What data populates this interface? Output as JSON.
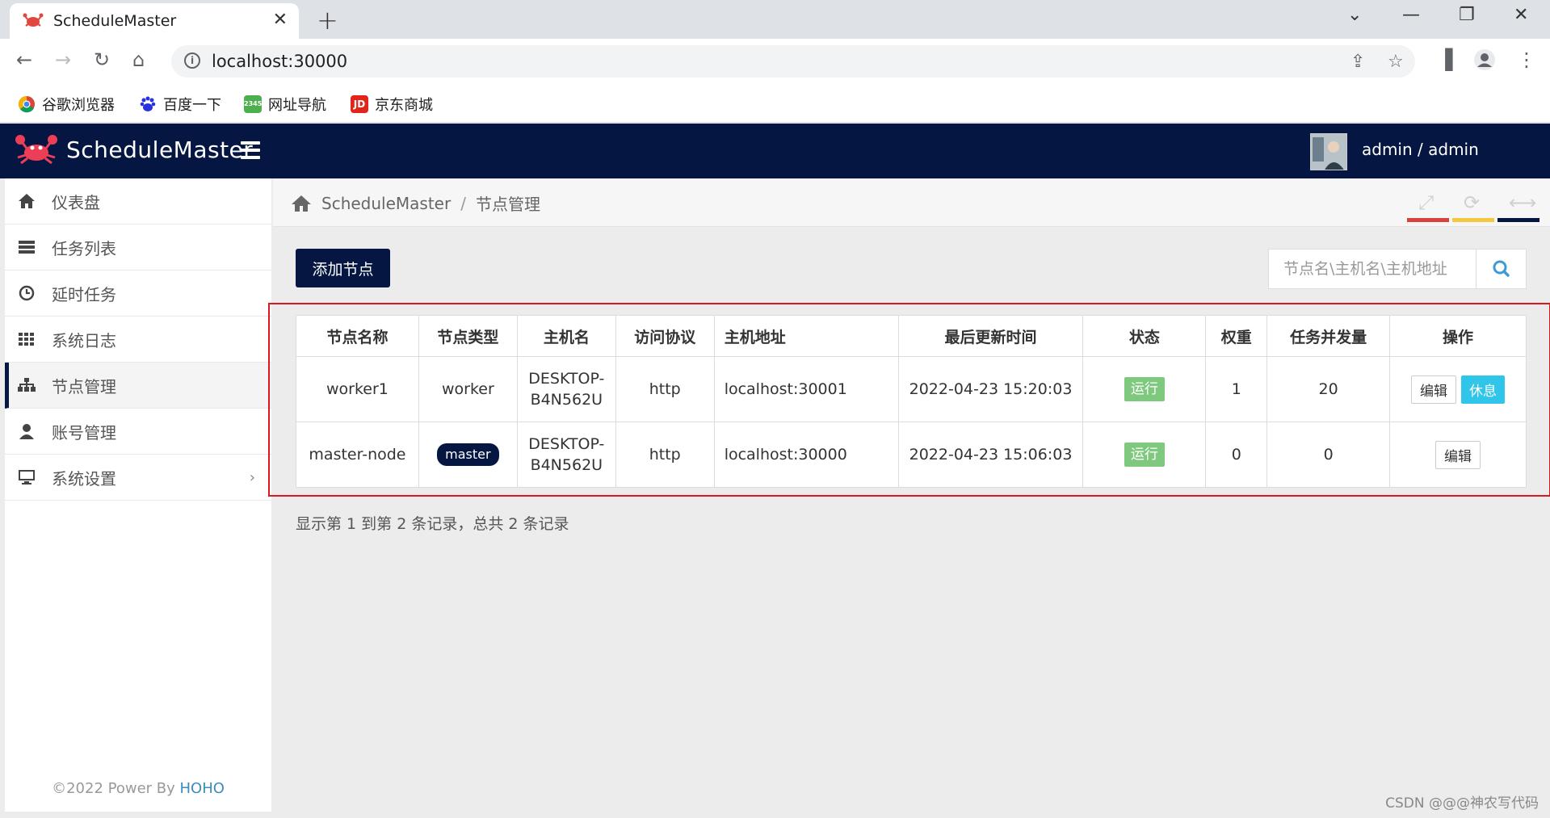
{
  "browser": {
    "tab_title": "ScheduleMaster",
    "tab_close": "✕",
    "new_tab": "+",
    "url": "localhost:30000",
    "bookmarks": [
      {
        "label": "谷歌浏览器",
        "icon": "chrome-icon"
      },
      {
        "label": "百度一下",
        "icon": "baidu-icon"
      },
      {
        "label": "网址导航",
        "icon": "2345-icon"
      },
      {
        "label": "京东商城",
        "icon": "jd-icon"
      }
    ],
    "bookmark_icon_text": {
      "jd": "JD",
      "nav": "2345"
    }
  },
  "header": {
    "brand": "ScheduleMaster",
    "user": "admin / admin"
  },
  "sidebar": {
    "items": [
      {
        "label": "仪表盘",
        "icon": "home-icon"
      },
      {
        "label": "任务列表",
        "icon": "list-icon"
      },
      {
        "label": "延时任务",
        "icon": "clock-icon"
      },
      {
        "label": "系统日志",
        "icon": "grid-icon"
      },
      {
        "label": "节点管理",
        "icon": "sitemap-icon",
        "active": true
      },
      {
        "label": "账号管理",
        "icon": "user-icon"
      },
      {
        "label": "系统设置",
        "icon": "monitor-icon"
      }
    ],
    "chevron": "›",
    "footer_prefix": "©2022 Power By ",
    "footer_link": "HOHO"
  },
  "breadcrumb": {
    "root": "ScheduleMaster",
    "sep": "/",
    "current": "节点管理"
  },
  "toolbar": {
    "add_label": "添加节点",
    "search_placeholder": "节点名\\主机名\\主机地址"
  },
  "table": {
    "headers": [
      "节点名称",
      "节点类型",
      "主机名",
      "访问协议",
      "主机地址",
      "最后更新时间",
      "状态",
      "权重",
      "任务并发量",
      "操作"
    ],
    "rows": [
      {
        "name": "worker1",
        "type": "worker",
        "host_line1": "DESKTOP-",
        "host_line2": "B4N562U",
        "protocol": "http",
        "address": "localhost:30001",
        "updated": "2022-04-23 15:20:03",
        "status": "运行",
        "weight": "1",
        "concurrency": "20",
        "edit": "编辑",
        "rest": "休息"
      },
      {
        "name": "master-node",
        "type": "master",
        "host_line1": "DESKTOP-",
        "host_line2": "B4N562U",
        "protocol": "http",
        "address": "localhost:30000",
        "updated": "2022-04-23 15:06:03",
        "status": "运行",
        "weight": "0",
        "concurrency": "0",
        "edit": "编辑"
      }
    ]
  },
  "summary": "显示第 1 到第 2 条记录，总共 2 条记录",
  "watermark": "CSDN @@@神农写代码",
  "colors": {
    "navy": "#041641",
    "run_green": "#7fc97f",
    "rest_cyan": "#2fc6ea",
    "bar_red": "#d9423a",
    "bar_yellow": "#f5c842",
    "frame_red": "#d9191f"
  }
}
